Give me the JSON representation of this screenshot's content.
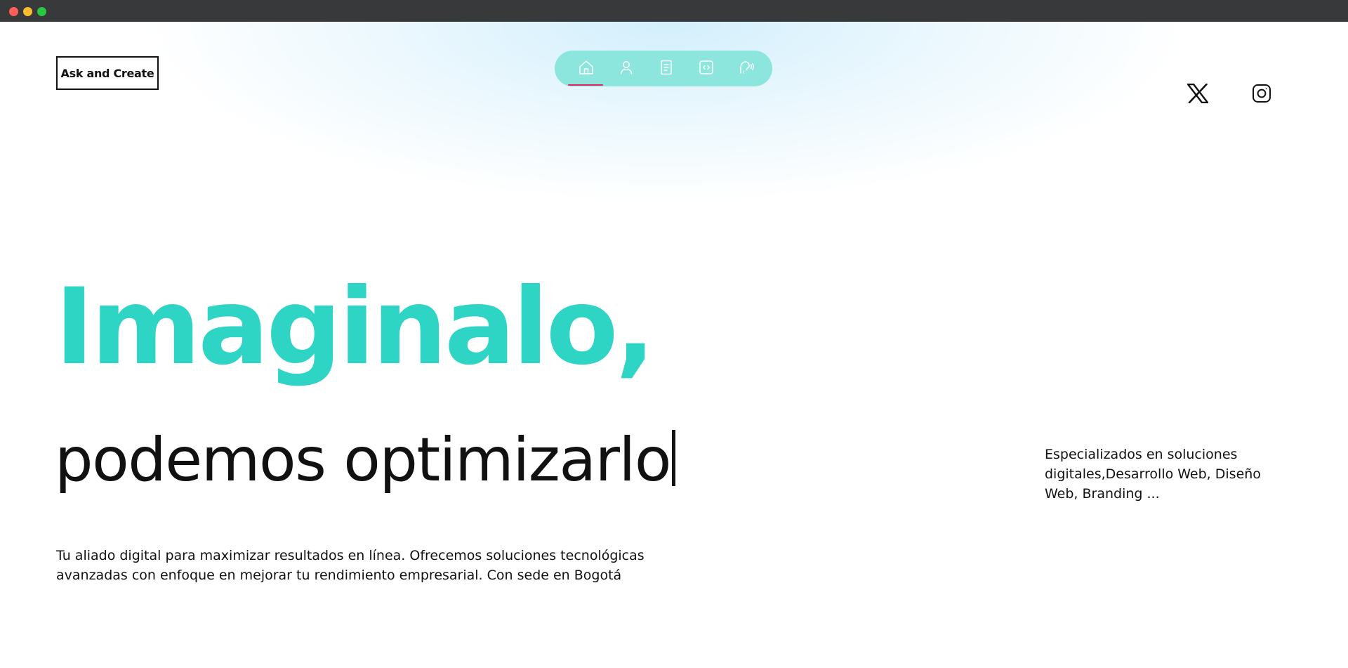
{
  "window": {
    "controls": [
      "close",
      "minimize",
      "maximize"
    ]
  },
  "header": {
    "brand_label": "Ask and Create",
    "nav": [
      {
        "icon": "home-icon",
        "active": true
      },
      {
        "icon": "user-icon",
        "active": false
      },
      {
        "icon": "document-icon",
        "active": false
      },
      {
        "icon": "code-icon",
        "active": false
      },
      {
        "icon": "voice-icon",
        "active": false
      }
    ],
    "social": [
      {
        "icon": "x-twitter-icon"
      },
      {
        "icon": "instagram-icon"
      }
    ]
  },
  "hero": {
    "title": "Imaginalo,",
    "subtitle": "podemos optimizarlo",
    "description": "Tu aliado digital para maximizar resultados en línea. Ofrecemos soluciones tecnológicas avanzadas con enfoque en mejorar tu rendimiento empresarial. Con sede en Bogotá",
    "side_text": "Especializados en soluciones digitales,Desarrollo Web, Diseño Web, Branding ..."
  },
  "colors": {
    "accent": "#2fd5c4",
    "nav_bg": "#8de6dd",
    "active_underline": "#e0245e",
    "titlebar": "#38393b"
  }
}
